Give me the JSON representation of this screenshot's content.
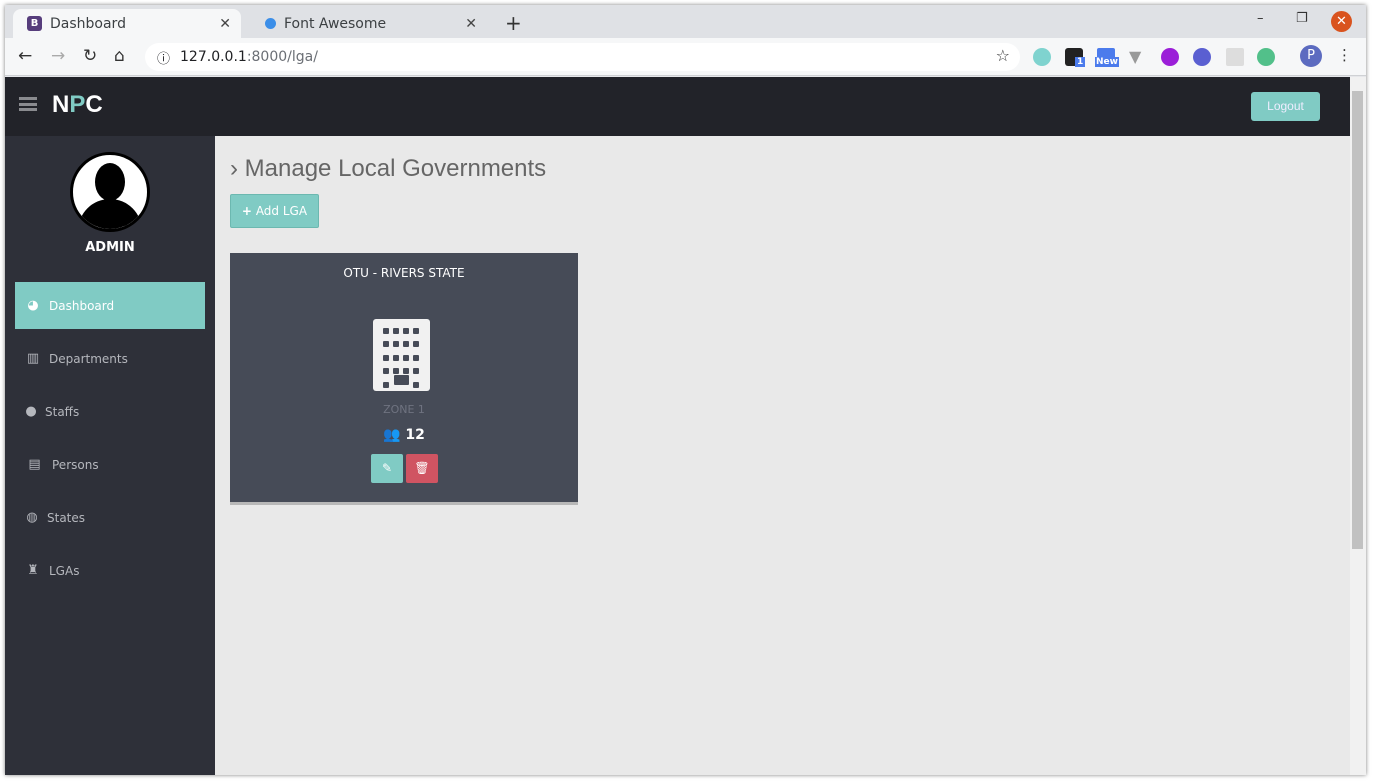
{
  "browser": {
    "tabs": [
      {
        "label": "Dashboard",
        "favicon": "B",
        "active": true
      },
      {
        "label": "Font Awesome",
        "favicon": "font-awesome-icon",
        "active": false
      }
    ],
    "url_host": "127.0.0.1",
    "url_rest": ":8000/lga/",
    "extensions": {
      "badge1": "1",
      "badge2": "New"
    },
    "profile": "P"
  },
  "navbar": {
    "brand_n": "N",
    "brand_p": "P",
    "brand_c": "C",
    "logout": "Logout"
  },
  "sidebar": {
    "user": "ADMIN",
    "items": [
      {
        "label": "Dashboard",
        "icon": "tachometer-icon",
        "active": true
      },
      {
        "label": "Departments",
        "icon": "building-icon"
      },
      {
        "label": "Staffs",
        "icon": "user-icon"
      },
      {
        "label": "Persons",
        "icon": "id-card-icon"
      },
      {
        "label": "States",
        "icon": "globe-icon"
      },
      {
        "label": "LGAs",
        "icon": "fort-icon"
      }
    ]
  },
  "main": {
    "title": "Manage Local Governments",
    "add_label": "Add LGA",
    "cards": [
      {
        "title": "OTU - RIVERS STATE",
        "zone": "ZONE 1",
        "count": "12"
      }
    ]
  },
  "colors": {
    "accent": "#80cbc4",
    "danger": "#d05462",
    "navbar": "#222329",
    "sidebar": "#2e3039",
    "card": "#464b57"
  }
}
